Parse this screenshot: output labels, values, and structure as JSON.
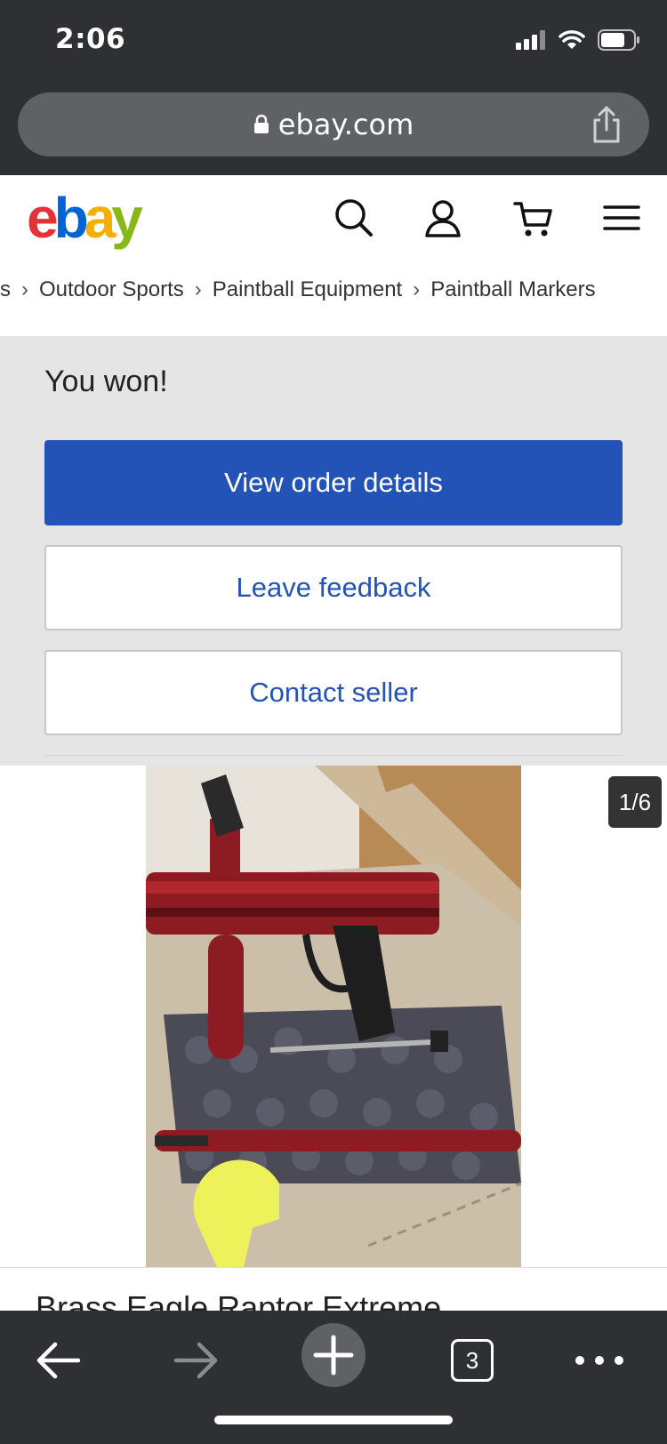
{
  "status_bar": {
    "time": "2:06",
    "icons": [
      "signal-icon",
      "wifi-icon",
      "battery-icon"
    ]
  },
  "browser": {
    "url": "ebay.com",
    "lock_icon": "lock-icon",
    "share_icon": "share-icon"
  },
  "header": {
    "logo": {
      "e": "e",
      "b": "b",
      "a": "a",
      "y": "y"
    },
    "icons": [
      "search-icon",
      "user-icon",
      "cart-icon",
      "menu-icon"
    ]
  },
  "breadcrumb": {
    "items": [
      "s",
      "Outdoor Sports",
      "Paintball Equipment",
      "Paintball Markers"
    ]
  },
  "won": {
    "title": "You won!",
    "view_order": "View order details",
    "leave_feedback": "Leave feedback",
    "contact_seller": "Contact seller"
  },
  "gallery": {
    "counter": "1/6"
  },
  "item": {
    "title": "Brass Eagle Raptor Extreme"
  },
  "toolbar": {
    "tabs_count": "3"
  },
  "colors": {
    "primary_button": "#2353b7",
    "link": "#2353b7",
    "chrome_bg": "#2f3033",
    "panel_bg": "#e5e5e5"
  }
}
